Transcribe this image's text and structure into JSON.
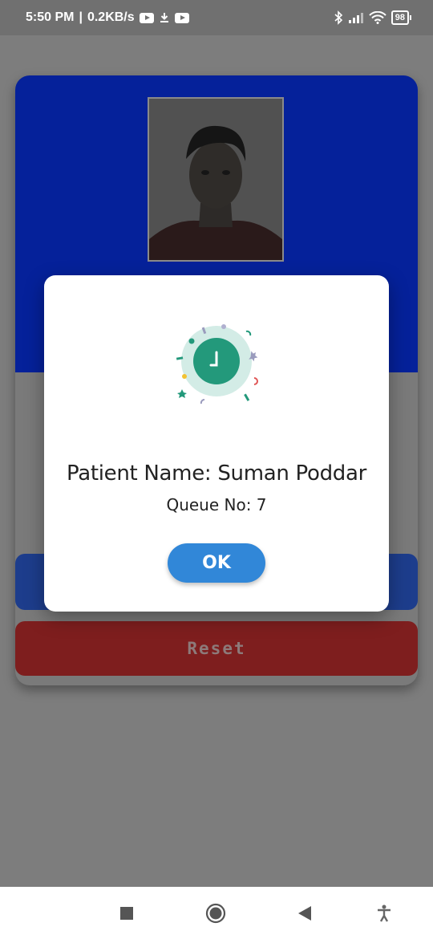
{
  "status_bar": {
    "time": "5:50 PM",
    "separator": "|",
    "speed": "0.2KB/s",
    "battery": "98",
    "icons": [
      "youtube-icon",
      "download-icon",
      "youtube-icon",
      "bluetooth-icon",
      "signal-icon",
      "wifi-icon",
      "battery-icon"
    ]
  },
  "background_card": {
    "header_color": "#05219a",
    "photo_alt_icon": "person-photo",
    "reset_label": "Reset",
    "reset_color": "#7e1e1e",
    "primary_button_color": "#1d3d8c"
  },
  "dialog": {
    "illustration_icon": "clock-success-icon",
    "patient_name": "Patient Name: Suman Poddar",
    "queue_no": "Queue No: 7",
    "ok_label": "OK",
    "accent": "#3187d8"
  },
  "nav_bar": {
    "icons": [
      "recents-square-icon",
      "home-circle-icon",
      "back-triangle-icon",
      "accessibility-icon"
    ]
  }
}
